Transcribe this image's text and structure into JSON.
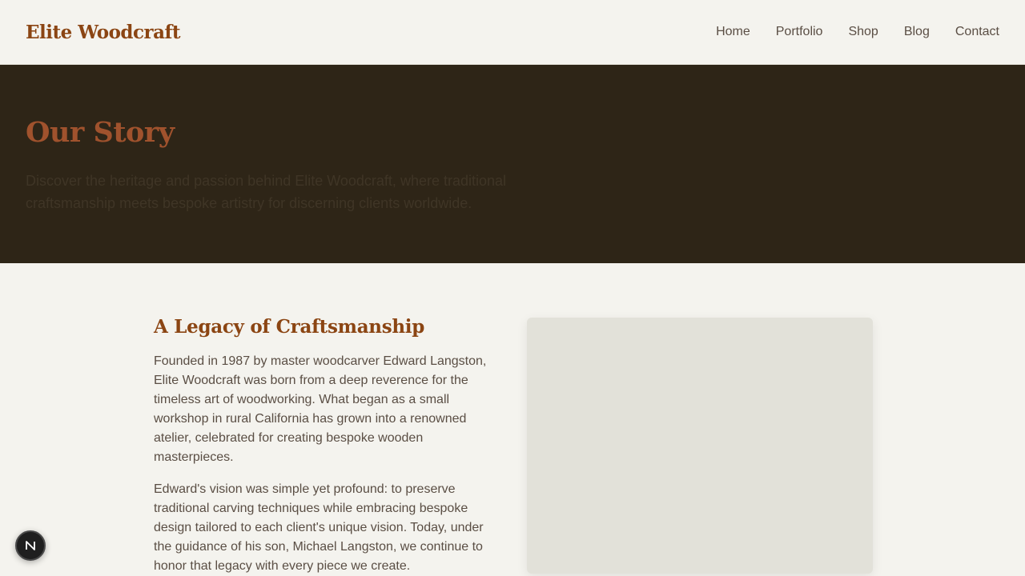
{
  "header": {
    "logo": "Elite Woodcraft",
    "nav": [
      "Home",
      "Portfolio",
      "Shop",
      "Blog",
      "Contact"
    ]
  },
  "hero": {
    "title": "Our Story",
    "subtitle": "Discover the heritage and passion behind Elite Woodcraft, where traditional craftsmanship meets bespoke artistry for discerning clients worldwide."
  },
  "story": {
    "title": "A Legacy of Craftsmanship",
    "paragraphs": [
      "Founded in 1987 by master woodcarver Edward Langston, Elite Woodcraft was born from a deep reverence for the timeless art of woodworking. What began as a small workshop in rural California has grown into a renowned atelier, celebrated for creating bespoke wooden masterpieces.",
      "Edward's vision was simple yet profound: to preserve traditional carving techniques while embracing bespoke design tailored to each client's unique vision. Today, under the guidance of his son, Michael Langston, we continue to honor that legacy with every piece we create."
    ]
  },
  "icons": {
    "fab": "n-logo-icon"
  },
  "colors": {
    "brand": "#8b4513",
    "hero_bg": "#2e2517",
    "page_bg": "#f4f3ee"
  }
}
